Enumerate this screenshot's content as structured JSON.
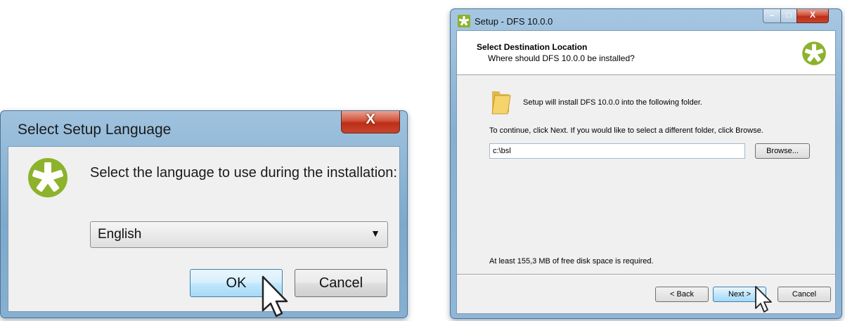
{
  "language_dialog": {
    "title": "Select Setup Language",
    "close_label": "X",
    "prompt": "Select the language to use during the installation:",
    "selected_language": "English",
    "ok_label": "OK",
    "cancel_label": "Cancel"
  },
  "setup_wizard": {
    "title": "Setup - DFS 10.0.0",
    "close_label": "X",
    "page_title": "Select Destination Location",
    "page_subtitle": "Where should DFS 10.0.0 be installed?",
    "install_info": "Setup will install DFS 10.0.0 into the following folder.",
    "instructions": "To continue, click Next. If you would like to select a different folder, click Browse.",
    "destination_path": "c:\\bsl",
    "browse_label": "Browse...",
    "disk_space": "At least 155,3 MB of free disk space is required.",
    "back_label": "< Back",
    "next_label": "Next >",
    "cancel_label": "Cancel"
  },
  "colors": {
    "logo_green": "#8db22c",
    "title_bar_blue": "#86afd1",
    "close_red": "#c8452d"
  },
  "icons": [
    "star-logo-icon",
    "folder-icon",
    "close-icon",
    "minimize-icon",
    "maximize-icon",
    "dropdown-arrow-icon",
    "mouse-pointer-icon"
  ]
}
